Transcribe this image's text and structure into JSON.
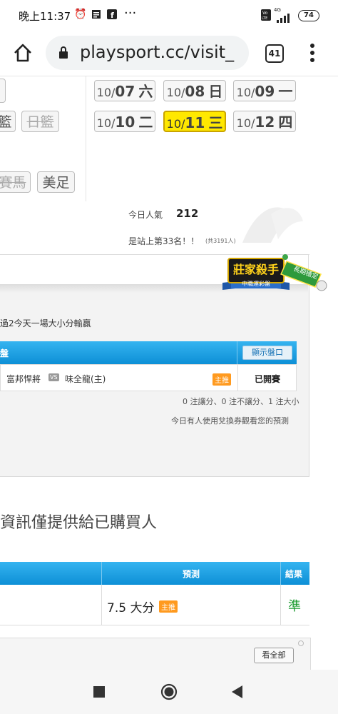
{
  "status_bar": {
    "time": "晚上11:37",
    "more": "···",
    "network": "4G",
    "battery": "74"
  },
  "browser": {
    "url": "playsport.cc/visit_",
    "tab_count": "41"
  },
  "dates": [
    {
      "month": "10/",
      "day": "07",
      "weekday": "六",
      "active": false
    },
    {
      "month": "10/",
      "day": "08",
      "weekday": "日",
      "active": false
    },
    {
      "month": "10/",
      "day": "09",
      "weekday": "一",
      "active": false
    },
    {
      "month": "10/",
      "day": "10",
      "weekday": "二",
      "active": false
    },
    {
      "month": "10/",
      "day": "11",
      "weekday": "三",
      "active": true
    },
    {
      "month": "10/",
      "day": "12",
      "weekday": "四",
      "active": false
    }
  ],
  "sports": {
    "basketball": "籃",
    "japan_basketball": "日籃",
    "horse_racing": "賽馬",
    "american_football": "美足"
  },
  "popularity": {
    "label": "今日人氣",
    "value": "212",
    "rank_text": "是站上第33名！！",
    "rank_total": "(共3191人)"
  },
  "badge": {
    "title": "莊家殺手",
    "subtitle": "中職運彩盤",
    "ribbon": "長期穩定"
  },
  "panel": {
    "intro_text": "過2今天一場大小分輸贏",
    "header_left": "盤",
    "show_odds_button": "顯示盤口",
    "match": {
      "away_team": "富邦悍將",
      "vs": "VS",
      "home_team": "味全龍(主)",
      "tag": "主推",
      "status": "已開賽"
    },
    "summary": "0 注讓分、0 注不讓分、1 注大小",
    "coupon_note": "今日有人使用兌換券觀看您的預測"
  },
  "notice": "資訊僅提供給已購買人",
  "results_table": {
    "columns": [
      "預測",
      "結果"
    ],
    "rows": [
      {
        "prediction": "7.5 大分",
        "tag": "主推",
        "result": "準"
      }
    ]
  },
  "view_all_button": "看全部",
  "colors": {
    "accent_blue": "#1a9de0",
    "active_date": "#ffe800",
    "result_green": "#1a9b2e",
    "tag_orange": "#ff9a1f"
  }
}
